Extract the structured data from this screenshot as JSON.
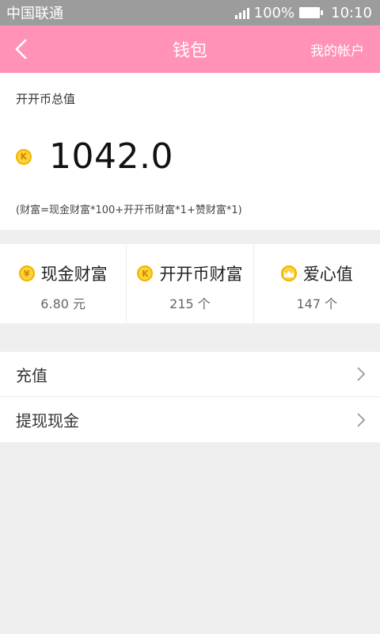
{
  "status": {
    "carrier": "中国联通",
    "battery": "100%",
    "time": "10:10"
  },
  "nav": {
    "title": "钱包",
    "right": "我的帐户"
  },
  "total": {
    "label": "开开币总值",
    "coin_letter": "K",
    "amount": "1042.0",
    "formula": "(财富=现金财富*100+开开币财富*1+赞财富*1)"
  },
  "assets": [
    {
      "icon": "yen-coin-icon",
      "glyph": "¥",
      "name": "现金财富",
      "value": "6.80 元"
    },
    {
      "icon": "k-coin-icon",
      "glyph": "K",
      "name": "开开币财富",
      "value": "215 个"
    },
    {
      "icon": "crown-icon",
      "glyph": "",
      "name": "爱心值",
      "value": "147 个"
    }
  ],
  "menu": [
    {
      "label": "充值"
    },
    {
      "label": "提现现金"
    }
  ],
  "colors": {
    "nav": "#ff92b6",
    "status": "#9c9c9c",
    "coin": "#ffd23a"
  }
}
